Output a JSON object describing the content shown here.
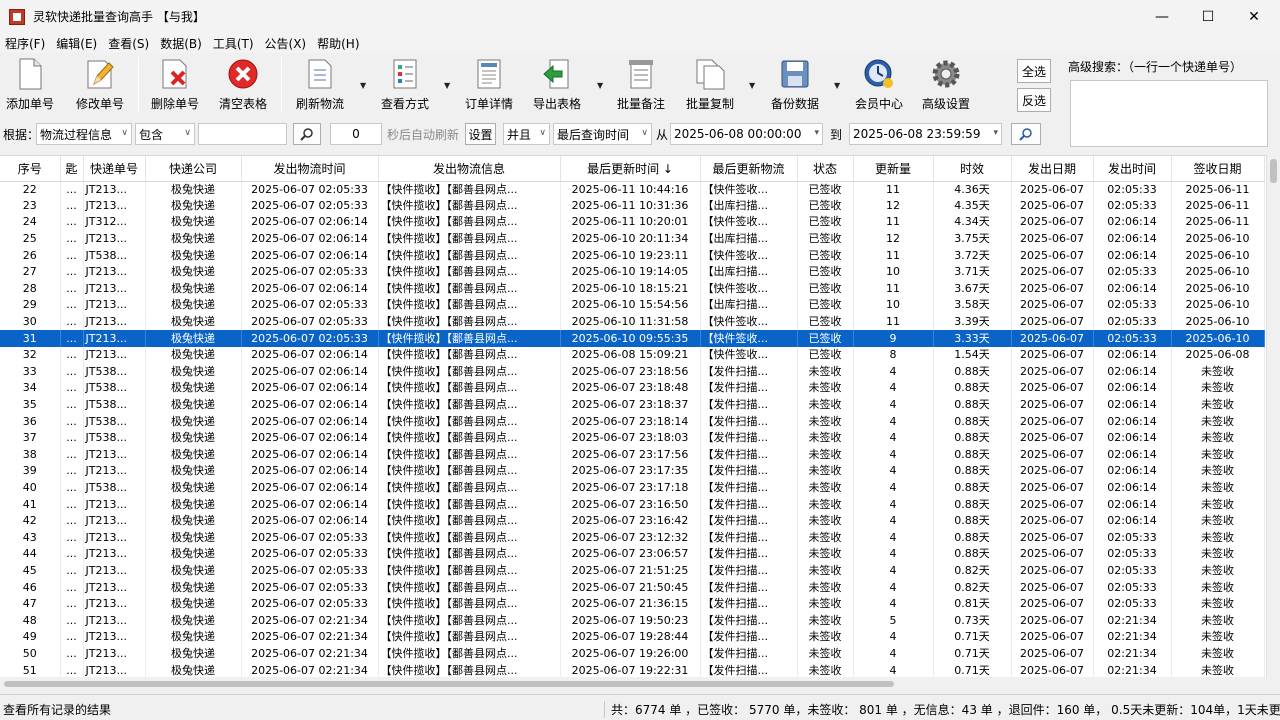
{
  "window": {
    "title": "灵软快递批量查询高手 【与我】",
    "minimize": "—",
    "maximize": "☐",
    "close": "✕"
  },
  "menu": [
    "程序(F)",
    "编辑(E)",
    "查看(S)",
    "数据(B)",
    "工具(T)",
    "公告(X)",
    "帮助(H)"
  ],
  "toolbar": {
    "add": "添加单号",
    "edit": "修改单号",
    "delete": "删除单号",
    "clear": "清空表格",
    "refresh": "刷新物流",
    "view": "查看方式",
    "detail": "订单详情",
    "export": "导出表格",
    "note": "批量备注",
    "copy": "批量复制",
    "backup": "备份数据",
    "member": "会员中心",
    "settings": "高级设置",
    "select_all": "全选",
    "invert": "反选",
    "advanced_search": "高级搜索：（一行一个快递单号）"
  },
  "filter": {
    "by_label": "根据：",
    "by_value": "物流过程信息",
    "op_value": "包含",
    "keyword": "",
    "seconds": "0",
    "auto_refresh": "秒后自动刷新",
    "set": "设置",
    "logic": "并且",
    "time_field": "最后查询时间",
    "from_label": "从",
    "from": "2025-06-08 00:00:00",
    "to_label": "到",
    "to": "2025-06-08 23:59:59"
  },
  "columns": [
    "序号",
    "匙",
    "快递单号",
    "快递公司",
    "发出物流时间",
    "发出物流信息",
    "最后更新时间 ↓",
    "最后更新物流",
    "状态",
    "更新量",
    "时效",
    "发出日期",
    "发出时间",
    "签收日期"
  ],
  "rows": [
    [
      "22",
      "...",
      "JT213...",
      "极兔快递",
      "2025-06-07 02:05:33",
      "【快件揽收】【鄱善县网点...",
      "2025-06-11 10:44:16",
      "【快件签收...",
      "已签收",
      "11",
      "4.36天",
      "2025-06-07",
      "02:05:33",
      "2025-06-11"
    ],
    [
      "23",
      "...",
      "JT213...",
      "极兔快递",
      "2025-06-07 02:05:33",
      "【快件揽收】【鄱善县网点...",
      "2025-06-11 10:31:36",
      "【出库扫描...",
      "已签收",
      "12",
      "4.35天",
      "2025-06-07",
      "02:05:33",
      "2025-06-11"
    ],
    [
      "24",
      "...",
      "JT312...",
      "极兔快递",
      "2025-06-07 02:06:14",
      "【快件揽收】【鄱善县网点...",
      "2025-06-11 10:20:01",
      "【快件签收...",
      "已签收",
      "11",
      "4.34天",
      "2025-06-07",
      "02:06:14",
      "2025-06-11"
    ],
    [
      "25",
      "...",
      "JT213...",
      "极兔快递",
      "2025-06-07 02:06:14",
      "【快件揽收】【鄱善县网点...",
      "2025-06-10 20:11:34",
      "【出库扫描...",
      "已签收",
      "12",
      "3.75天",
      "2025-06-07",
      "02:06:14",
      "2025-06-10"
    ],
    [
      "26",
      "...",
      "JT538...",
      "极兔快递",
      "2025-06-07 02:06:14",
      "【快件揽收】【鄱善县网点...",
      "2025-06-10 19:23:11",
      "【快件签收...",
      "已签收",
      "11",
      "3.72天",
      "2025-06-07",
      "02:06:14",
      "2025-06-10"
    ],
    [
      "27",
      "...",
      "JT213...",
      "极兔快递",
      "2025-06-07 02:05:33",
      "【快件揽收】【鄱善县网点...",
      "2025-06-10 19:14:05",
      "【出库扫描...",
      "已签收",
      "10",
      "3.71天",
      "2025-06-07",
      "02:05:33",
      "2025-06-10"
    ],
    [
      "28",
      "...",
      "JT213...",
      "极兔快递",
      "2025-06-07 02:06:14",
      "【快件揽收】【鄱善县网点...",
      "2025-06-10 18:15:21",
      "【快件签收...",
      "已签收",
      "11",
      "3.67天",
      "2025-06-07",
      "02:06:14",
      "2025-06-10"
    ],
    [
      "29",
      "...",
      "JT213...",
      "极兔快递",
      "2025-06-07 02:05:33",
      "【快件揽收】【鄱善县网点...",
      "2025-06-10 15:54:56",
      "【出库扫描...",
      "已签收",
      "10",
      "3.58天",
      "2025-06-07",
      "02:05:33",
      "2025-06-10"
    ],
    [
      "30",
      "...",
      "JT213...",
      "极兔快递",
      "2025-06-07 02:05:33",
      "【快件揽收】【鄱善县网点...",
      "2025-06-10 11:31:58",
      "【快件签收...",
      "已签收",
      "11",
      "3.39天",
      "2025-06-07",
      "02:05:33",
      "2025-06-10"
    ],
    [
      "31",
      "...",
      "JT213...",
      "极兔快递",
      "2025-06-07 02:05:33",
      "【快件揽收】【鄱善县网点...",
      "2025-06-10 09:55:35",
      "【快件签收...",
      "已签收",
      "9",
      "3.33天",
      "2025-06-07",
      "02:05:33",
      "2025-06-10"
    ],
    [
      "32",
      "...",
      "JT213...",
      "极兔快递",
      "2025-06-07 02:06:14",
      "【快件揽收】【鄱善县网点...",
      "2025-06-08 15:09:21",
      "【快件签收...",
      "已签收",
      "8",
      "1.54天",
      "2025-06-07",
      "02:06:14",
      "2025-06-08"
    ],
    [
      "33",
      "...",
      "JT538...",
      "极兔快递",
      "2025-06-07 02:06:14",
      "【快件揽收】【鄱善县网点...",
      "2025-06-07 23:18:56",
      "【发件扫描...",
      "未签收",
      "4",
      "0.88天",
      "2025-06-07",
      "02:06:14",
      "未签收"
    ],
    [
      "34",
      "...",
      "JT538...",
      "极兔快递",
      "2025-06-07 02:06:14",
      "【快件揽收】【鄱善县网点...",
      "2025-06-07 23:18:48",
      "【发件扫描...",
      "未签收",
      "4",
      "0.88天",
      "2025-06-07",
      "02:06:14",
      "未签收"
    ],
    [
      "35",
      "...",
      "JT538...",
      "极兔快递",
      "2025-06-07 02:06:14",
      "【快件揽收】【鄱善县网点...",
      "2025-06-07 23:18:37",
      "【发件扫描...",
      "未签收",
      "4",
      "0.88天",
      "2025-06-07",
      "02:06:14",
      "未签收"
    ],
    [
      "36",
      "...",
      "JT538...",
      "极兔快递",
      "2025-06-07 02:06:14",
      "【快件揽收】【鄱善县网点...",
      "2025-06-07 23:18:14",
      "【发件扫描...",
      "未签收",
      "4",
      "0.88天",
      "2025-06-07",
      "02:06:14",
      "未签收"
    ],
    [
      "37",
      "...",
      "JT538...",
      "极兔快递",
      "2025-06-07 02:06:14",
      "【快件揽收】【鄱善县网点...",
      "2025-06-07 23:18:03",
      "【发件扫描...",
      "未签收",
      "4",
      "0.88天",
      "2025-06-07",
      "02:06:14",
      "未签收"
    ],
    [
      "38",
      "...",
      "JT213...",
      "极兔快递",
      "2025-06-07 02:06:14",
      "【快件揽收】【鄱善县网点...",
      "2025-06-07 23:17:56",
      "【发件扫描...",
      "未签收",
      "4",
      "0.88天",
      "2025-06-07",
      "02:06:14",
      "未签收"
    ],
    [
      "39",
      "...",
      "JT213...",
      "极兔快递",
      "2025-06-07 02:06:14",
      "【快件揽收】【鄱善县网点...",
      "2025-06-07 23:17:35",
      "【发件扫描...",
      "未签收",
      "4",
      "0.88天",
      "2025-06-07",
      "02:06:14",
      "未签收"
    ],
    [
      "40",
      "...",
      "JT538...",
      "极兔快递",
      "2025-06-07 02:06:14",
      "【快件揽收】【鄱善县网点...",
      "2025-06-07 23:17:18",
      "【发件扫描...",
      "未签收",
      "4",
      "0.88天",
      "2025-06-07",
      "02:06:14",
      "未签收"
    ],
    [
      "41",
      "...",
      "JT213...",
      "极兔快递",
      "2025-06-07 02:06:14",
      "【快件揽收】【鄱善县网点...",
      "2025-06-07 23:16:50",
      "【发件扫描...",
      "未签收",
      "4",
      "0.88天",
      "2025-06-07",
      "02:06:14",
      "未签收"
    ],
    [
      "42",
      "...",
      "JT213...",
      "极兔快递",
      "2025-06-07 02:06:14",
      "【快件揽收】【鄱善县网点...",
      "2025-06-07 23:16:42",
      "【发件扫描...",
      "未签收",
      "4",
      "0.88天",
      "2025-06-07",
      "02:06:14",
      "未签收"
    ],
    [
      "43",
      "...",
      "JT213...",
      "极兔快递",
      "2025-06-07 02:05:33",
      "【快件揽收】【鄱善县网点...",
      "2025-06-07 23:12:32",
      "【发件扫描...",
      "未签收",
      "4",
      "0.88天",
      "2025-06-07",
      "02:05:33",
      "未签收"
    ],
    [
      "44",
      "...",
      "JT213...",
      "极兔快递",
      "2025-06-07 02:05:33",
      "【快件揽收】【鄱善县网点...",
      "2025-06-07 23:06:57",
      "【发件扫描...",
      "未签收",
      "4",
      "0.88天",
      "2025-06-07",
      "02:05:33",
      "未签收"
    ],
    [
      "45",
      "...",
      "JT213...",
      "极兔快递",
      "2025-06-07 02:05:33",
      "【快件揽收】【鄱善县网点...",
      "2025-06-07 21:51:25",
      "【发件扫描...",
      "未签收",
      "4",
      "0.82天",
      "2025-06-07",
      "02:05:33",
      "未签收"
    ],
    [
      "46",
      "...",
      "JT213...",
      "极兔快递",
      "2025-06-07 02:05:33",
      "【快件揽收】【鄱善县网点...",
      "2025-06-07 21:50:45",
      "【发件扫描...",
      "未签收",
      "4",
      "0.82天",
      "2025-06-07",
      "02:05:33",
      "未签收"
    ],
    [
      "47",
      "...",
      "JT213...",
      "极兔快递",
      "2025-06-07 02:05:33",
      "【快件揽收】【鄱善县网点...",
      "2025-06-07 21:36:15",
      "【发件扫描...",
      "未签收",
      "4",
      "0.81天",
      "2025-06-07",
      "02:05:33",
      "未签收"
    ],
    [
      "48",
      "...",
      "JT213...",
      "极兔快递",
      "2025-06-07 02:21:34",
      "【快件揽收】【鄱善县网点...",
      "2025-06-07 19:50:23",
      "【发件扫描...",
      "未签收",
      "5",
      "0.73天",
      "2025-06-07",
      "02:21:34",
      "未签收"
    ],
    [
      "49",
      "...",
      "JT213...",
      "极兔快递",
      "2025-06-07 02:21:34",
      "【快件揽收】【鄱善县网点...",
      "2025-06-07 19:28:44",
      "【发件扫描...",
      "未签收",
      "4",
      "0.71天",
      "2025-06-07",
      "02:21:34",
      "未签收"
    ],
    [
      "50",
      "...",
      "JT213...",
      "极兔快递",
      "2025-06-07 02:21:34",
      "【快件揽收】【鄱善县网点...",
      "2025-06-07 19:26:00",
      "【发件扫描...",
      "未签收",
      "4",
      "0.71天",
      "2025-06-07",
      "02:21:34",
      "未签收"
    ],
    [
      "51",
      "...",
      "JT213...",
      "极兔快递",
      "2025-06-07 02:21:34",
      "【快件揽收】【鄱善县网点...",
      "2025-06-07 19:22:31",
      "【发件扫描...",
      "未签收",
      "4",
      "0.71天",
      "2025-06-07",
      "02:21:34",
      "未签收"
    ]
  ],
  "selected_row": "31",
  "status": {
    "left": "查看所有记录的结果",
    "right": "共：6774 单 ，已签收：  5770 单，未签收：  801 单 ，无信息：43 单 ，退回件：160 单， 0.5天未更新：104单，1天未更"
  },
  "colors": {
    "selection": "#0a64c8"
  }
}
